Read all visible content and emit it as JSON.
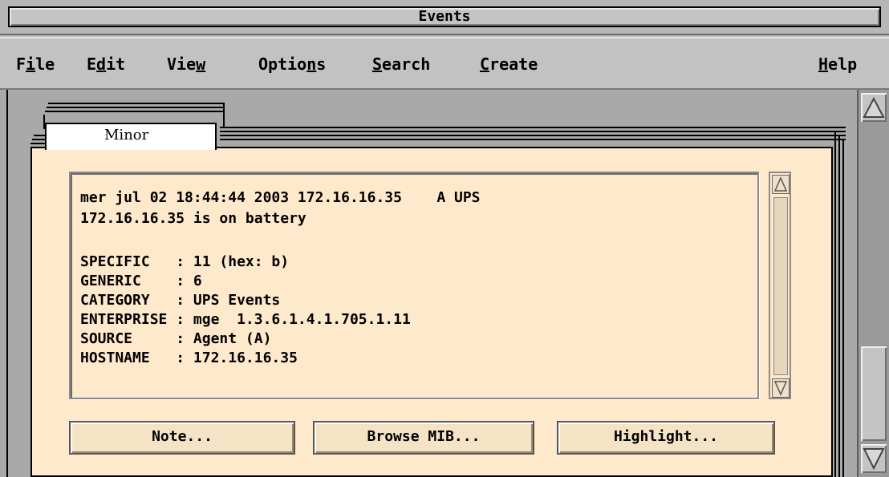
{
  "window": {
    "title": "Events"
  },
  "menu": {
    "file": {
      "pre": "F",
      "mn": "i",
      "post": "le"
    },
    "edit": {
      "pre": "E",
      "mn": "d",
      "post": "it"
    },
    "view": {
      "pre": "Vie",
      "mn": "w",
      "post": ""
    },
    "options": {
      "pre": "Optio",
      "mn": "n",
      "post": "s"
    },
    "search": {
      "pre": "",
      "mn": "S",
      "post": "earch"
    },
    "create": {
      "pre": "",
      "mn": "C",
      "post": "reate"
    },
    "help": {
      "pre": "",
      "mn": "H",
      "post": "elp"
    }
  },
  "tab": {
    "label": "Minor"
  },
  "event": {
    "headline": "mer jul 02 18:44:44 2003 172.16.16.35    A UPS",
    "headline2": "172.16.16.35 is on battery",
    "fields": [
      {
        "key": "SPECIFIC   : ",
        "value": "11 (hex: b)"
      },
      {
        "key": "GENERIC    : ",
        "value": "6"
      },
      {
        "key": "CATEGORY   : ",
        "value": "UPS Events"
      },
      {
        "key": "ENTERPRISE : ",
        "value": "mge  1.3.6.1.4.1.705.1.11"
      },
      {
        "key": "SOURCE     : ",
        "value": "Agent (A)"
      },
      {
        "key": "HOSTNAME   : ",
        "value": "172.16.16.35"
      }
    ]
  },
  "buttons": {
    "note": "Note...",
    "browse_mib": "Browse MIB...",
    "highlight": "Highlight..."
  },
  "icons": {
    "scroll_up": "triangle-up-icon",
    "scroll_down": "triangle-down-icon"
  }
}
